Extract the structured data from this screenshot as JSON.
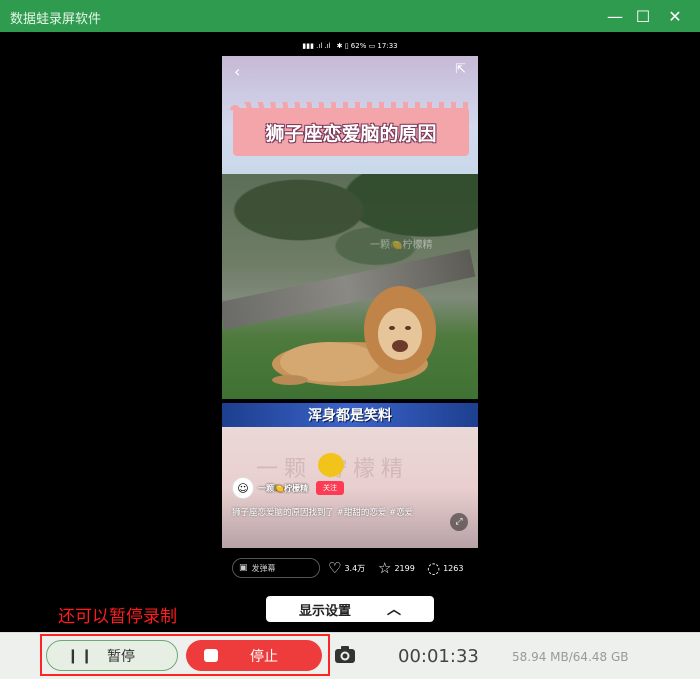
{
  "window": {
    "title": "数据蛙录屏软件",
    "minimize_glyph": "—",
    "maximize_glyph": "☐",
    "close_glyph": "✕"
  },
  "phone": {
    "status_bar": {
      "left_icons": "▮▮▮ .ıl .ıl",
      "right_text": "✱ ▯ 62% ▭ 17:33"
    },
    "video": {
      "title_banner": "狮子座恋爱脑的原因",
      "watermark_small": "一颗🍋柠檬精",
      "caption": "浑身都是笑料",
      "big_watermark": "一颗 柠檬精",
      "author": {
        "name": "一颗🍋柠檬精",
        "follow_label": "关注"
      },
      "description": "狮子座恋爱脑的原因找到了 #甜甜的恋爱 #恋爱"
    },
    "interaction_bar": {
      "danmu_label": "发弹幕",
      "likes": "3.4万",
      "favorites": "2199",
      "comments": "1263"
    }
  },
  "display_settings": {
    "label": "显示设置",
    "chevron": "︿"
  },
  "annotation": {
    "text": "还可以暂停录制"
  },
  "controls": {
    "pause_label": "暂停",
    "stop_label": "停止",
    "timer": "00:01:33",
    "storage": "58.94 MB/64.48 GB"
  },
  "icons": {
    "back": "chevron-left-icon",
    "share": "share-icon",
    "expand": "expand-icon",
    "heart": "heart-icon",
    "star": "star-icon",
    "comment": "comment-icon",
    "camera": "camera-icon",
    "pause": "pause-icon",
    "stop": "stop-icon"
  },
  "colors": {
    "titlebar": "#2e9b4f",
    "stop_button": "#ee3b3b",
    "annotation_red": "#ff1c1c",
    "pause_border": "#6fa87a"
  }
}
